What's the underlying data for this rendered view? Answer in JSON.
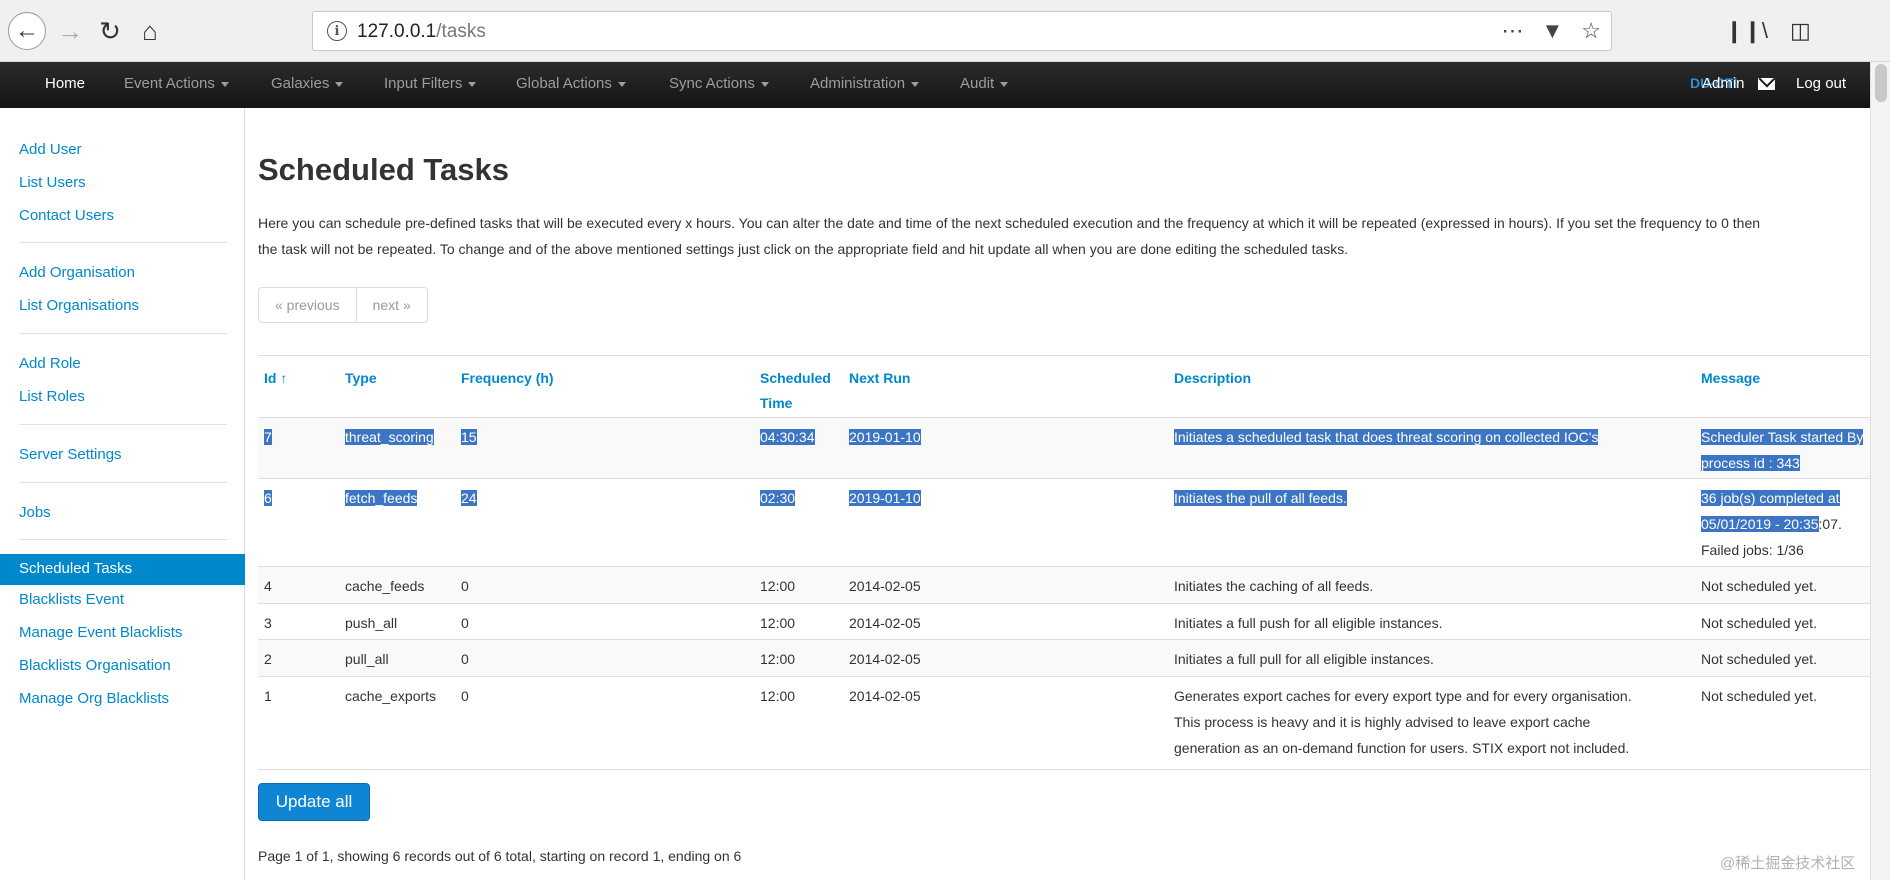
{
  "browser": {
    "url_prefix": "127.0.0.1",
    "url_path": "/tasks"
  },
  "navbar": {
    "items": [
      "Home",
      "Event Actions",
      "Galaxies",
      "Input Filters",
      "Global Actions",
      "Sync Actions",
      "Administration",
      "Audit"
    ],
    "org": "DU-CTI",
    "admin": "Admin",
    "logout": "Log out"
  },
  "sidebar": {
    "items": [
      "Add User",
      "List Users",
      "Contact Users",
      "Add Organisation",
      "List Organisations",
      "Add Role",
      "List Roles",
      "Server Settings",
      "Jobs",
      "Scheduled Tasks",
      "Blacklists Event",
      "Manage Event Blacklists",
      "Blacklists Organisation",
      "Manage Org Blacklists"
    ]
  },
  "main": {
    "title": "Scheduled Tasks",
    "intro_line1": "Here you can schedule pre-defined tasks that will be executed every x hours. You can alter the date and time of the next scheduled execution and the frequency at which it will be repeated (expressed in hours). If you set the frequency to 0 then",
    "intro_line2": "the task will not be repeated. To change and of the above mentioned settings just click on the appropriate field and hit update all when you are done editing the scheduled tasks.",
    "pager_prev": "« previous",
    "pager_next": "next »",
    "update_button": "Update all",
    "footer": "Page 1 of 1, showing 6 records out of 6 total, starting on record 1, ending on 6"
  },
  "table": {
    "headers": {
      "id": "Id ↑",
      "type": "Type",
      "frequency": "Frequency (h)",
      "scheduled_time_1": "Scheduled",
      "scheduled_time_2": "Time",
      "next_run": "Next Run",
      "description": "Description",
      "message": "Message"
    },
    "rows": [
      {
        "id": "7",
        "type": "threat_scoring",
        "frequency": "15",
        "time": "04:30:34",
        "next_run": "2019-01-10",
        "description": "Initiates a scheduled task that does threat scoring on collected IOC's",
        "message_1": "Scheduler Task started By",
        "message_2": "process id : 343"
      },
      {
        "id": "6",
        "type": "fetch_feeds",
        "frequency": "24",
        "time": "02:30",
        "next_run": "2019-01-10",
        "description": "Initiates the pull of all feeds.",
        "message_1": "36 job(s) completed at",
        "message_2a": "05/01/2019 - 20:35",
        "message_2b": ":07.",
        "message_3": "Failed jobs: 1/36"
      },
      {
        "id": "4",
        "type": "cache_feeds",
        "frequency": "0",
        "time": "12:00",
        "next_run": "2014-02-05",
        "description": "Initiates the caching of all feeds.",
        "message_1": "Not scheduled yet."
      },
      {
        "id": "3",
        "type": "push_all",
        "frequency": "0",
        "time": "12:00",
        "next_run": "2014-02-05",
        "description": "Initiates a full push for all eligible instances.",
        "message_1": "Not scheduled yet."
      },
      {
        "id": "2",
        "type": "pull_all",
        "frequency": "0",
        "time": "12:00",
        "next_run": "2014-02-05",
        "description": "Initiates a full pull for all eligible instances.",
        "message_1": "Not scheduled yet."
      },
      {
        "id": "1",
        "type": "cache_exports",
        "frequency": "0",
        "time": "12:00",
        "next_run": "2014-02-05",
        "description_1": "Generates export caches for every export type and for every organisation.",
        "description_2": "This process is heavy and it is highly advised to leave export cache",
        "description_3": "generation as an on-demand function for users. STIX export not included.",
        "message_1": "Not scheduled yet."
      }
    ]
  },
  "watermark": "@稀土掘金技术社区",
  "colors": {
    "link": "#0088cc",
    "navbar": "#1b1b1b",
    "selection": "#3b75c3",
    "button": "#0e86d4"
  }
}
